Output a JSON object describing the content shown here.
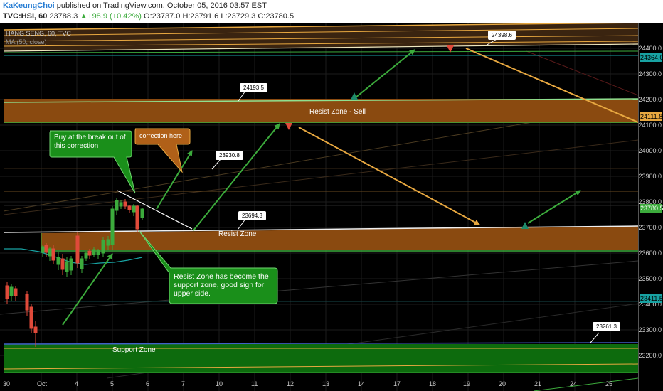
{
  "header": {
    "author": "KaKeungChoi",
    "published": "published on TradingView.com, October 05, 2016 03:57 EST",
    "symbol": "TVC:HSI, 60",
    "last": "23788.3",
    "change": "+98.9 (+0.42%)",
    "open": "O:23737.0",
    "high": "H:23791.6",
    "low": "L:23729.3",
    "close": "C:23780.5"
  },
  "legend": {
    "title": "HANG SENG, 60, TVC",
    "ma": "MA (50, close)"
  },
  "price_axis": {
    "labels": [
      "24400.0",
      "24300.0",
      "24200.0",
      "24100.0",
      "24000.0",
      "23900.0",
      "23800.0",
      "23700.0",
      "23600.0",
      "23500.0",
      "23400.0",
      "23300.0",
      "23200.0"
    ],
    "tags": [
      {
        "label": "24364.0",
        "bg": "#18a2a2",
        "fg": "#000"
      },
      {
        "label": "24111.8",
        "bg": "#e8a840",
        "fg": "#000"
      },
      {
        "label": "23780.5",
        "bg": "#3cab3c",
        "fg": "#fff"
      },
      {
        "label": "23411.5",
        "bg": "#18a2a2",
        "fg": "#000"
      }
    ]
  },
  "time_axis": [
    "30",
    "Oct",
    "4",
    "5",
    "6",
    "7",
    "10",
    "11",
    "12",
    "13",
    "14",
    "17",
    "18",
    "19",
    "20",
    "21",
    "24",
    "25"
  ],
  "annotations": {
    "buy_note": "Buy at the break out of this correction",
    "correction_note": "correction here",
    "support_note": "Resist Zone has become the support zone, good sign for upper side.",
    "resist_sell": "Resist Zone - Sell",
    "resist_zone": "Resist Zone",
    "support_zone": "Support Zone"
  },
  "callouts": [
    "24398.6",
    "24193.5",
    "23930.8",
    "23694.3",
    "23261.3"
  ],
  "colors": {
    "background": "#000000",
    "up": "#3cab3c",
    "down": "#e04a3a",
    "orange": "#e8a840",
    "zone_orange": "#8a4a10",
    "zone_green": "#0d6b0d",
    "ma": "#18a2a2"
  }
}
